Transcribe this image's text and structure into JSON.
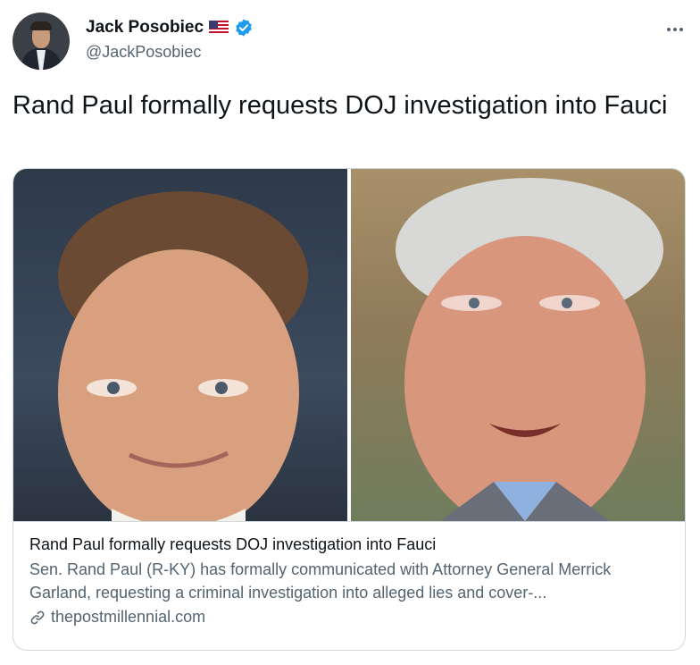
{
  "author": {
    "display_name": "Jack Posobiec",
    "handle": "@JackPosobiec",
    "flag_icon": "us-flag-icon",
    "verified_icon": "verified-badge-icon",
    "verified_color": "#1d9bf0"
  },
  "tweet": {
    "text": "Rand Paul formally requests DOJ investigation into Fauci"
  },
  "card": {
    "title": "Rand Paul formally requests DOJ investigation into Fauci",
    "description": "Sen. Rand Paul (R-KY) has formally communicated with Attorney General Merrick Garland, requesting a criminal investigation into alleged lies and cover-...",
    "domain": "thepostmillennial.com",
    "link_icon": "link-icon"
  },
  "colors": {
    "text_primary": "#0f1419",
    "text_secondary": "#536471",
    "border": "#cfd9de"
  }
}
